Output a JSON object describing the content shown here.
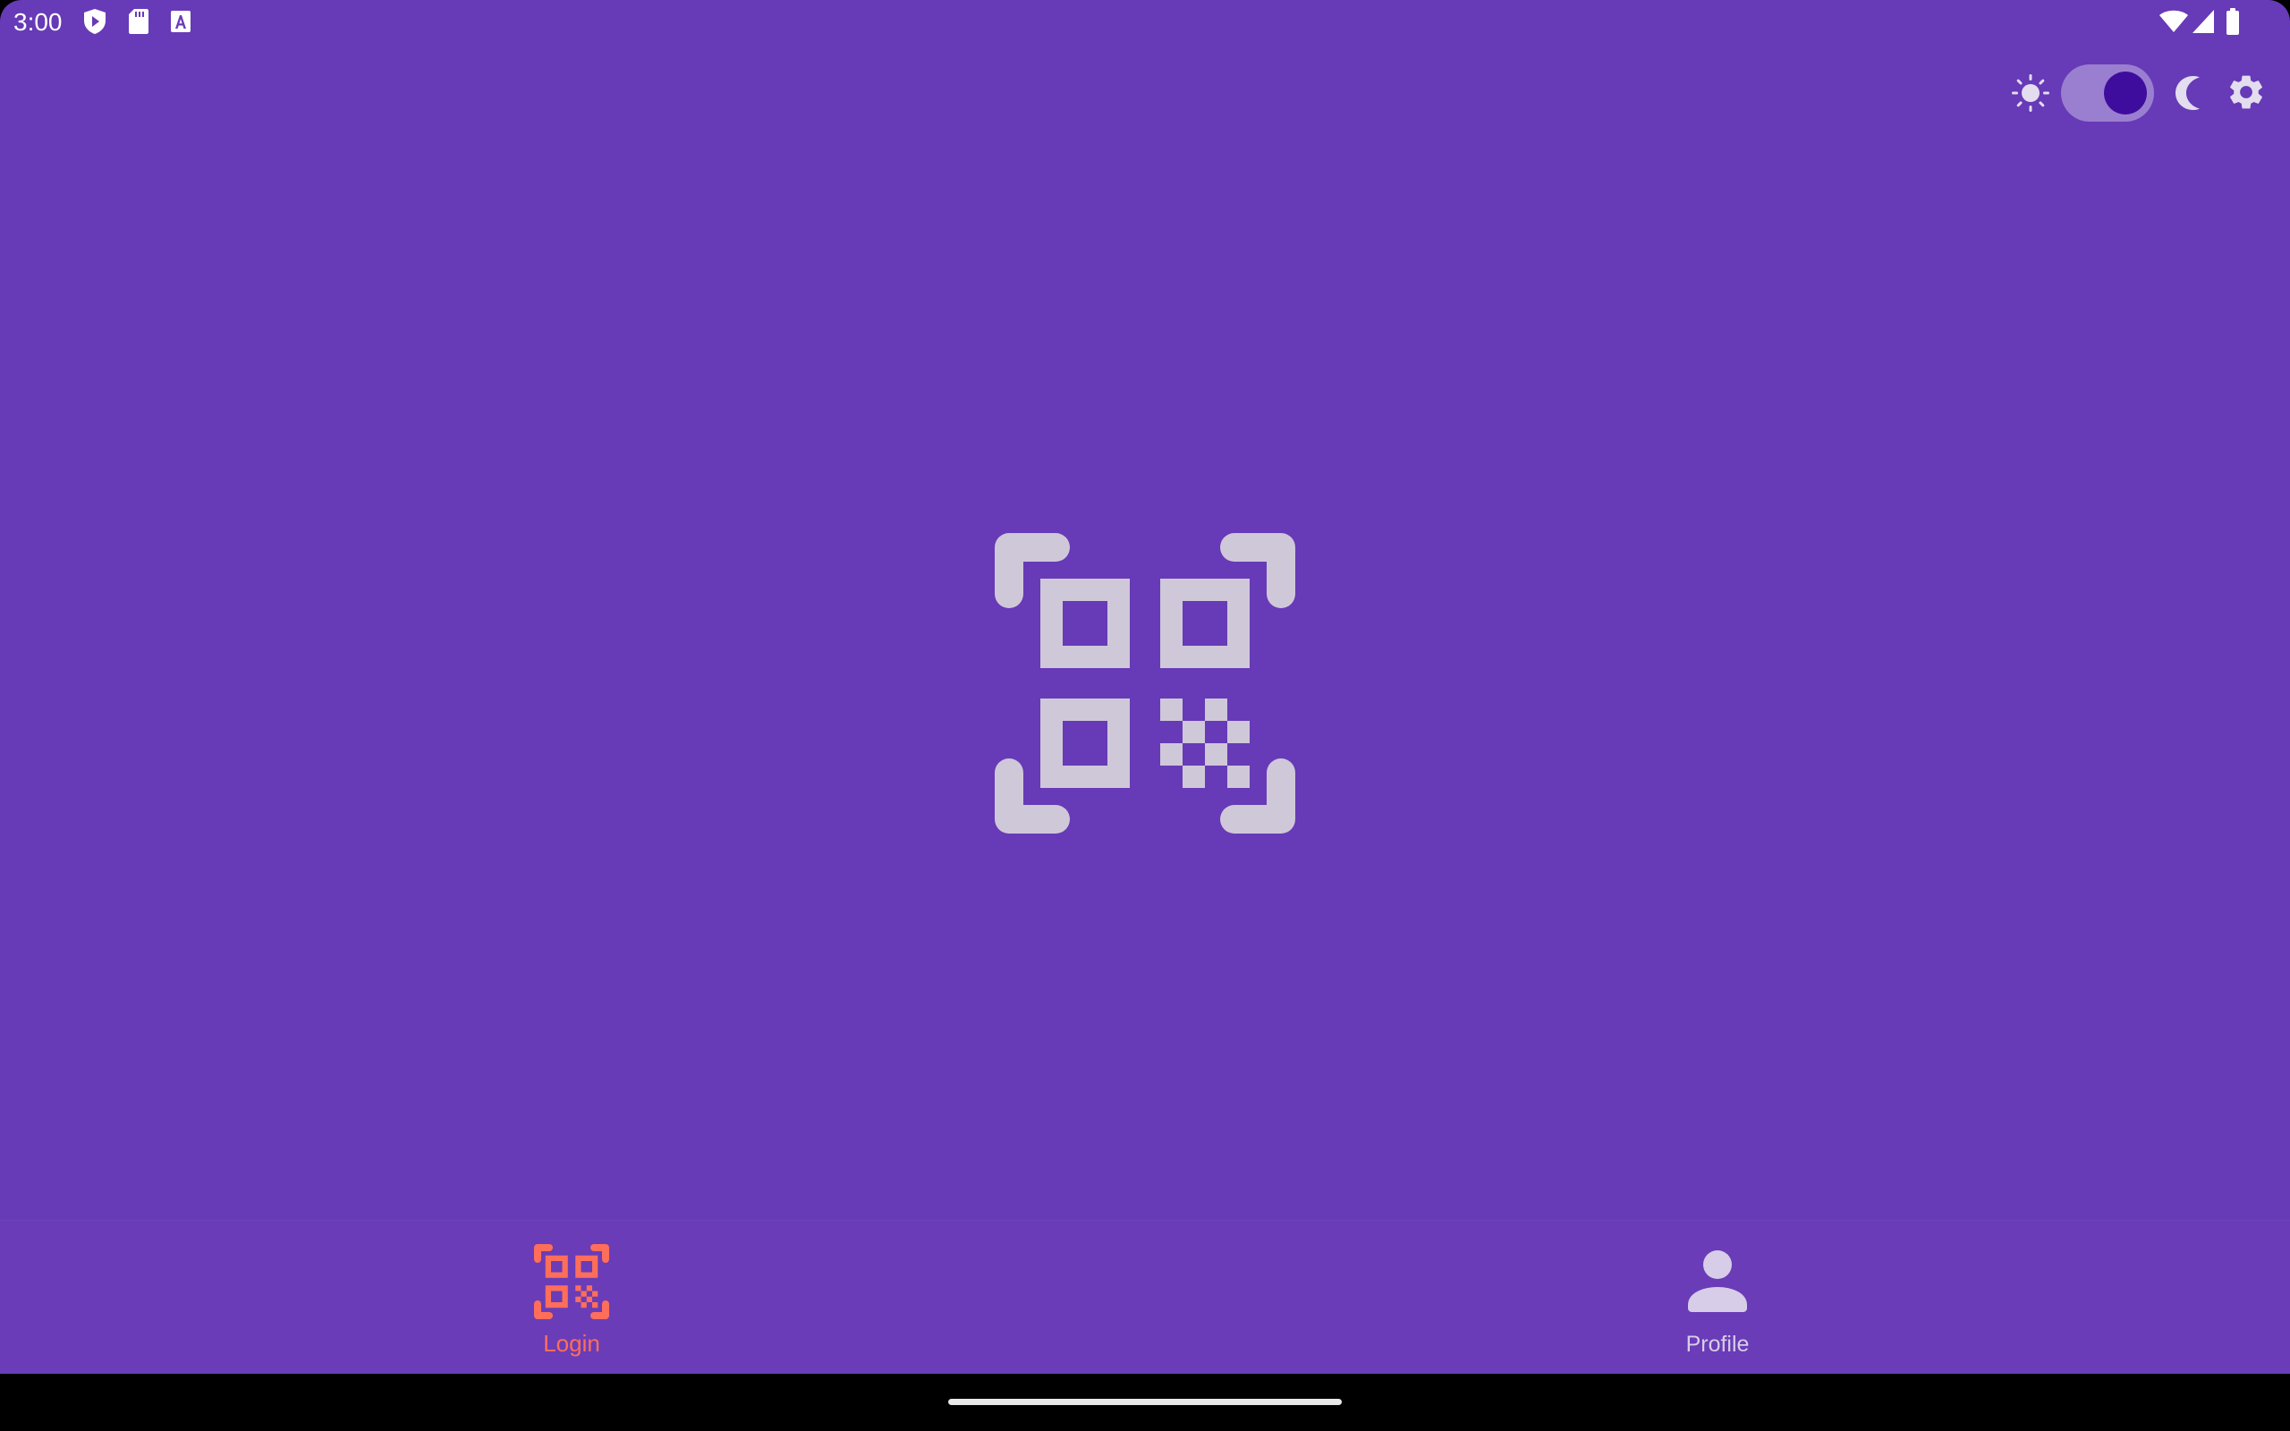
{
  "status_bar": {
    "time": "3:00",
    "left_icons": [
      "play-protect-icon",
      "sd-card-icon",
      "keyboard-a-icon"
    ],
    "right_icons": [
      "wifi-icon",
      "signal-icon",
      "battery-icon"
    ]
  },
  "theme_controls": {
    "light_icon": "sun-icon",
    "toggle_on": true,
    "dark_icon": "moon-icon",
    "settings_icon": "gear-icon"
  },
  "main": {
    "icon": "qr-code-scanner-icon"
  },
  "bottom_nav": {
    "items": [
      {
        "label": "Login",
        "icon": "qr-code-scanner-icon",
        "selected": true
      },
      {
        "label": "Profile",
        "icon": "person-icon",
        "selected": false
      }
    ]
  },
  "colors": {
    "background": "#673AB7",
    "icon_muted": "#CFC8D9",
    "accent": "#FF6E5A",
    "toggle_track": "#9A7FD0",
    "toggle_knob": "#3F0D9E"
  }
}
